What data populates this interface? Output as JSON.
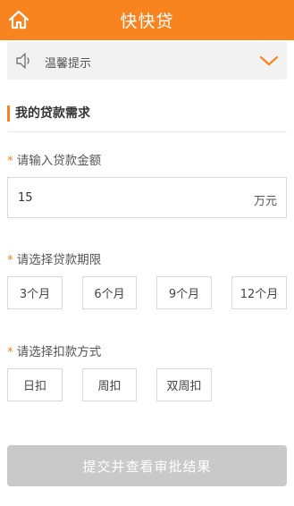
{
  "header": {
    "title": "快快贷",
    "home_icon": "home-icon"
  },
  "notice": {
    "label": "温馨提示",
    "speaker_icon": "speaker-icon",
    "chevron_icon": "chevron-down-icon"
  },
  "section": {
    "title": "我的贷款需求"
  },
  "amount": {
    "star": "*",
    "label": "请输入贷款金额",
    "value": "15",
    "unit": "万元"
  },
  "term": {
    "star": "*",
    "label": "请选择贷款期限",
    "options": [
      "3个月",
      "6个月",
      "9个月",
      "12个月"
    ]
  },
  "repay": {
    "star": "*",
    "label": "请选择扣款方式",
    "options": [
      "日扣",
      "周扣",
      "双周扣"
    ]
  },
  "submit": {
    "label": "提交并查看审批结果"
  },
  "colors": {
    "accent": "#f7841f",
    "submit_disabled": "#c9c9c9",
    "border": "#d9d9d9"
  }
}
